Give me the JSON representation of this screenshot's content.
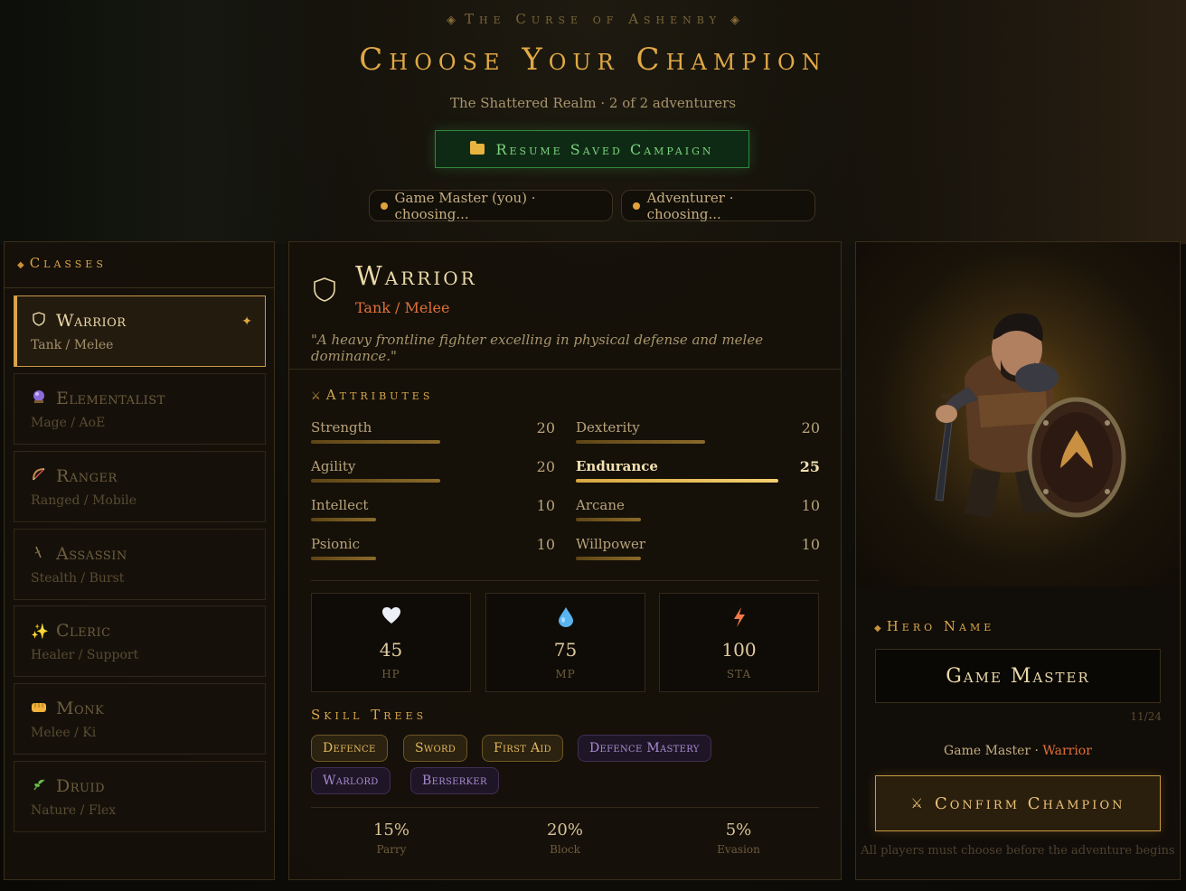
{
  "header": {
    "supertitle": "The Curse of Ashenby",
    "title": "Choose Your Champion",
    "subtitle": "The Shattered Realm · 2 of 2 adventurers",
    "resume_label": "Resume Saved Campaign"
  },
  "players": [
    {
      "label": "Game Master (you) · choosing..."
    },
    {
      "label": "Adventurer · choosing..."
    }
  ],
  "classes_panel": {
    "heading": "Classes",
    "items": [
      {
        "name": "Warrior",
        "role": "Tank / Melee",
        "icon": "shield-icon",
        "selected": true
      },
      {
        "name": "Elementalist",
        "role": "Mage / AoE",
        "icon": "crystal-ball-icon",
        "selected": false
      },
      {
        "name": "Ranger",
        "role": "Ranged / Mobile",
        "icon": "bow-icon",
        "selected": false
      },
      {
        "name": "Assassin",
        "role": "Stealth / Burst",
        "icon": "dagger-icon",
        "selected": false
      },
      {
        "name": "Cleric",
        "role": "Healer / Support",
        "icon": "sparkles-icon",
        "selected": false
      },
      {
        "name": "Monk",
        "role": "Melee / Ki",
        "icon": "fist-icon",
        "selected": false
      },
      {
        "name": "Druid",
        "role": "Nature / Flex",
        "icon": "herb-icon",
        "selected": false
      }
    ]
  },
  "detail": {
    "name": "Warrior",
    "role": "Tank / Melee",
    "quote": "\"A heavy frontline fighter excelling in physical defense and melee dominance.\"",
    "attributes_heading": "Attributes",
    "attributes": [
      {
        "name": "Strength",
        "value": 20,
        "highlight": false
      },
      {
        "name": "Dexterity",
        "value": 20,
        "highlight": false
      },
      {
        "name": "Agility",
        "value": 20,
        "highlight": false
      },
      {
        "name": "Endurance",
        "value": 25,
        "highlight": true
      },
      {
        "name": "Intellect",
        "value": 10,
        "highlight": false
      },
      {
        "name": "Arcane",
        "value": 10,
        "highlight": false
      },
      {
        "name": "Psionic",
        "value": 10,
        "highlight": false
      },
      {
        "name": "Willpower",
        "value": 10,
        "highlight": false
      }
    ],
    "attribute_max": 25,
    "stats": [
      {
        "value": "45",
        "label": "HP",
        "icon": "heart-icon"
      },
      {
        "value": "75",
        "label": "MP",
        "icon": "droplet-icon"
      },
      {
        "value": "100",
        "label": "STA",
        "icon": "lightning-icon"
      }
    ],
    "skills_heading": "Skill Trees",
    "skills": [
      {
        "label": "Defence",
        "tier": "gold"
      },
      {
        "label": "Sword",
        "tier": "gold"
      },
      {
        "label": "First Aid",
        "tier": "gold"
      },
      {
        "label": "Defence Mastery",
        "tier": "purple"
      },
      {
        "label": "Warlord",
        "tier": "purple"
      },
      {
        "label": "Berserker",
        "tier": "purple"
      }
    ],
    "defenses": [
      {
        "value": "15%",
        "label": "Parry"
      },
      {
        "value": "20%",
        "label": "Block"
      },
      {
        "value": "5%",
        "label": "Evasion"
      }
    ]
  },
  "hero": {
    "name_heading": "Hero Name",
    "name_value": "Game Master",
    "name_count": "11/24",
    "summary_player": "Game Master · ",
    "summary_class": "Warrior",
    "confirm_label": "Confirm Champion",
    "confirm_note": "All players must choose before the adventure begins"
  },
  "colors": {
    "accent_gold": "#e0a845",
    "role_orange": "#e0703a",
    "resume_green": "#7bd47f",
    "skill_purple": "#a98ad0"
  }
}
